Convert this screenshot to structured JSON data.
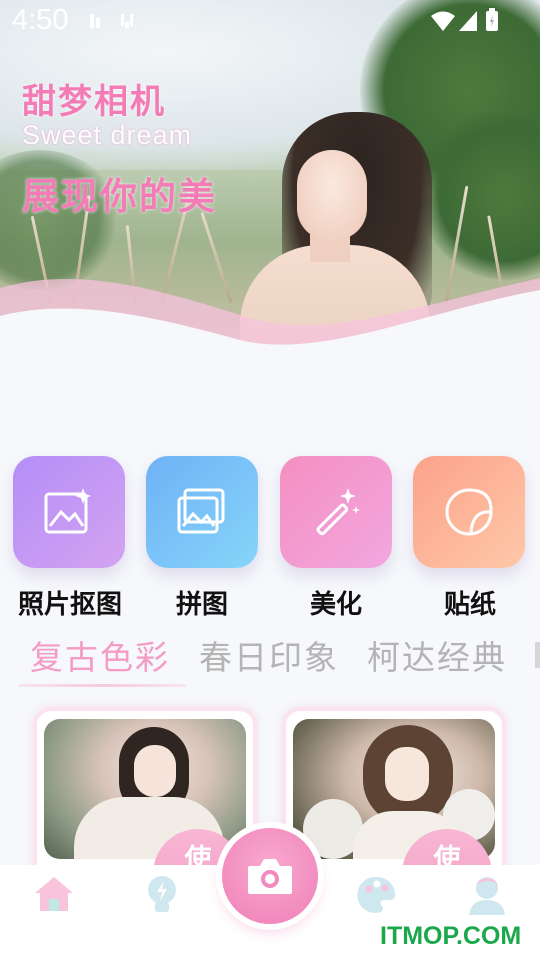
{
  "status_bar": {
    "time": "4:50"
  },
  "hero": {
    "title": "甜梦相机",
    "subtitle": "Sweet dream",
    "tagline": "展现你的美"
  },
  "features": [
    {
      "label": "照片抠图",
      "icon": "image-edit-icon",
      "color_from": "#b48ef7",
      "color_to": "#d4a3f1"
    },
    {
      "label": "拼图",
      "icon": "collage-icon",
      "color_from": "#6fb2f6",
      "color_to": "#86d4f9"
    },
    {
      "label": "美化",
      "icon": "magic-wand-icon",
      "color_from": "#f48fc1",
      "color_to": "#f2a7e0"
    },
    {
      "label": "贴纸",
      "icon": "sticker-icon",
      "color_from": "#fba28b",
      "color_to": "#ffc8a8"
    }
  ],
  "filter_tabs": [
    {
      "label": "复古色彩",
      "active": true
    },
    {
      "label": "春日印象",
      "active": false
    },
    {
      "label": "柯达经典",
      "active": false
    }
  ],
  "cards": [
    {
      "use_label": "使"
    },
    {
      "use_label": "使"
    }
  ],
  "bottom_nav": [
    {
      "icon": "home-icon",
      "active": true
    },
    {
      "icon": "lightbulb-icon",
      "active": false
    },
    {
      "icon": "camera-icon",
      "active": false
    },
    {
      "icon": "palette-icon",
      "active": false
    },
    {
      "icon": "profile-icon",
      "active": false
    }
  ],
  "colors": {
    "accent": "#f49cc4",
    "tab_inactive": "#b4b4b4",
    "watermark": "#1aa84a"
  },
  "watermark": "ITMOP.COM"
}
